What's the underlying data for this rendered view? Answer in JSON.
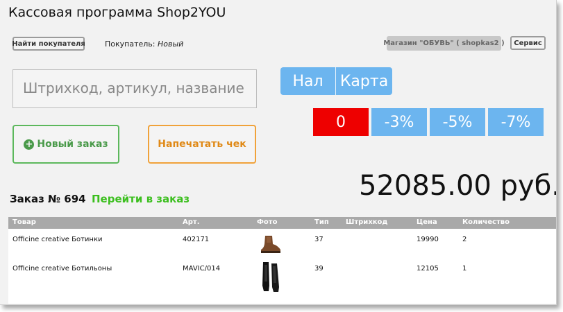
{
  "app": {
    "title": "Кассовая программа Shop2YOU"
  },
  "toolbar": {
    "find_customer": "Найти покупателя",
    "customer_label": "Покупатель:",
    "customer_value": "Новый",
    "shop": "Магазин \"ОБУВЬ\" ( shopkas2 )",
    "service": "Сервис"
  },
  "search": {
    "placeholder": "Штрихкод, артикул, название"
  },
  "payment": {
    "cash": "Нал",
    "card": "Карта"
  },
  "discounts": [
    "0",
    "-3%",
    "-5%",
    "-7%"
  ],
  "actions": {
    "new_order": "Новый заказ",
    "print_receipt": "Напечатать чек"
  },
  "order": {
    "number_label": "Заказ № 694",
    "goto": "Перейти в заказ",
    "total": "52085.00 руб."
  },
  "table": {
    "columns": [
      "Товар",
      "Арт.",
      "Фото",
      "Тип",
      "Штрихкод",
      "Цена",
      "Количество"
    ],
    "rows": [
      {
        "name": "Officine creative Ботинки",
        "article": "402171",
        "photo": "brown-boot-icon",
        "type": "37",
        "barcode": "",
        "price": "19990",
        "qty": "2"
      },
      {
        "name": "Officine creative Ботильоны",
        "article": "MAVIC/014",
        "photo": "black-boots-icon",
        "type": "39",
        "barcode": "",
        "price": "12105",
        "qty": "1"
      }
    ]
  },
  "colors": {
    "accent_blue": "#6cb5ef",
    "danger_red": "#ee0000",
    "green": "#5cb85c",
    "orange": "#f0a23a",
    "link_green": "#3cbf1f"
  }
}
